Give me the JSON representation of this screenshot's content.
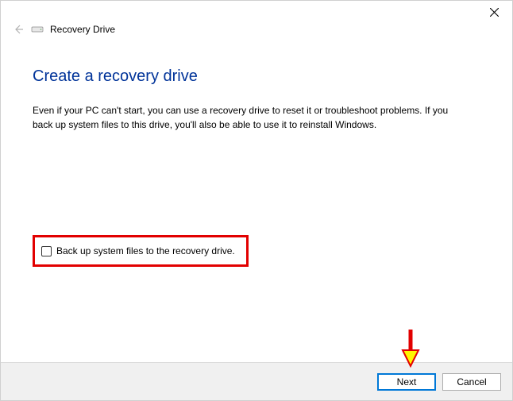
{
  "window": {
    "app_title": "Recovery Drive"
  },
  "content": {
    "heading": "Create a recovery drive",
    "body": "Even if your PC can't start, you can use a recovery drive to reset it or troubleshoot problems. If you back up system files to this drive, you'll also be able to use it to reinstall Windows."
  },
  "checkbox": {
    "label": "Back up system files to the recovery drive.",
    "checked": false
  },
  "footer": {
    "next": "Next",
    "cancel": "Cancel"
  },
  "annotations": {
    "highlight_checkbox": true,
    "arrow_points_to": "next-button"
  }
}
